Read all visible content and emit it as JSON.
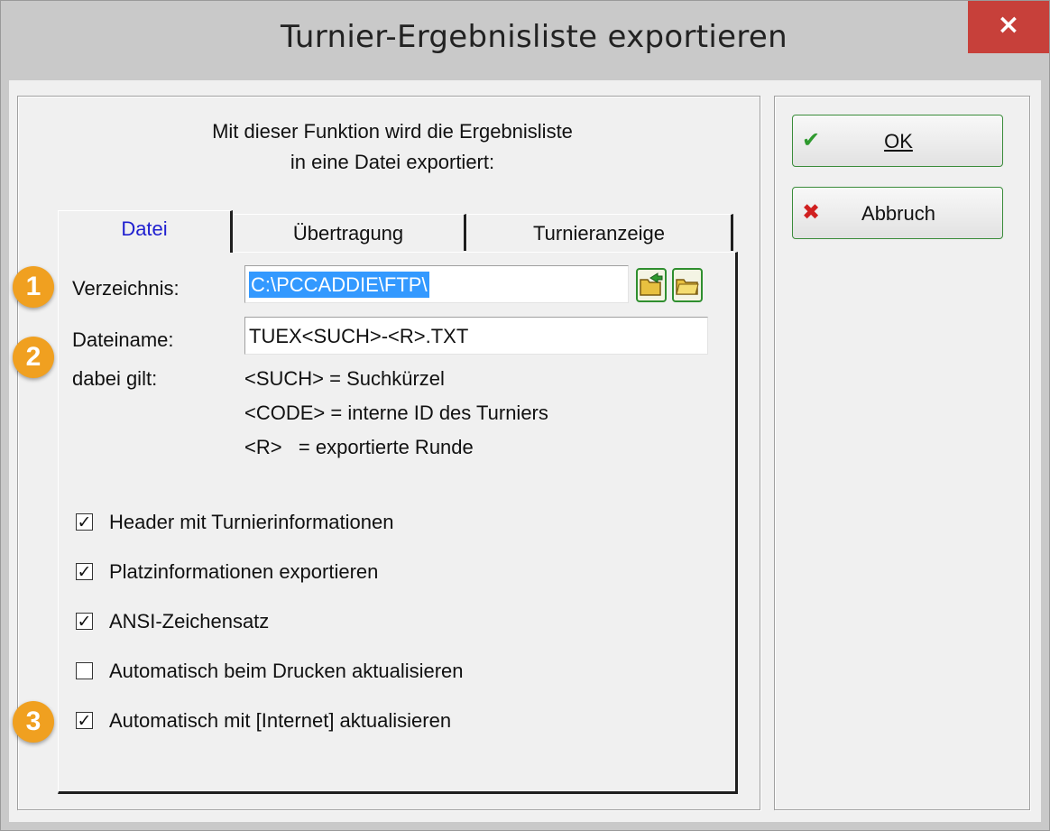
{
  "window": {
    "title": "Turnier-Ergebnisliste exportieren",
    "close_label": "×"
  },
  "intro": {
    "line1": "Mit dieser Funktion wird die Ergebnisliste",
    "line2": "in eine Datei exportiert:"
  },
  "tabs": [
    {
      "label": "Datei"
    },
    {
      "label": "Übertragung"
    },
    {
      "label": "Turnieranzeige"
    }
  ],
  "form": {
    "directory_label": "Verzeichnis:",
    "directory_value": "C:\\PCCADDIE\\FTP\\",
    "filename_label": "Dateiname:",
    "filename_value": "TUEX<SUCH>-<R>.TXT",
    "legend_label": "dabei gilt:",
    "legend": [
      "<SUCH> = Suchkürzel",
      "<CODE> = interne ID des Turniers",
      "<R>   = exportierte Runde"
    ]
  },
  "checkboxes": [
    {
      "label": "Header mit Turnierinformationen",
      "checked": true
    },
    {
      "label": "Platzinformationen exportieren",
      "checked": true
    },
    {
      "label": "ANSI-Zeichensatz",
      "checked": true
    },
    {
      "label": "Automatisch beim Drucken aktualisieren",
      "checked": false
    },
    {
      "label": "Automatisch mit [Internet] aktualisieren",
      "checked": true
    }
  ],
  "buttons": {
    "ok_label": "OK",
    "cancel_label": "Abbruch"
  },
  "badges": [
    "1",
    "2",
    "3"
  ],
  "icons": {
    "ok": "checkmark-icon",
    "cancel": "cross-icon",
    "browse": "folder-open-icon",
    "open": "folder-icon"
  },
  "colors": {
    "close_button": "#c7403a",
    "badge": "#f0a020",
    "selection": "#3399ff",
    "active_tab": "#2020d0"
  }
}
